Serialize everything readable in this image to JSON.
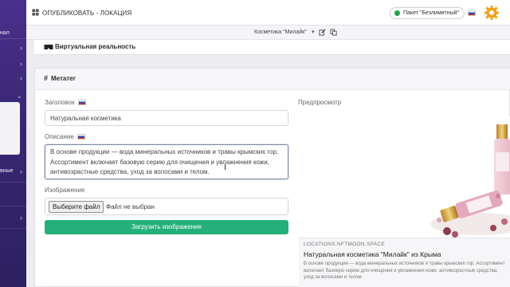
{
  "sidebar": {
    "items": [
      {
        "label": "нал"
      },
      {
        "label": ""
      },
      {
        "label": ""
      },
      {
        "label": ""
      },
      {
        "label": ""
      },
      {
        "label": "вные"
      },
      {
        "label": ""
      },
      {
        "label": ""
      },
      {
        "label": ""
      }
    ]
  },
  "topbar": {
    "title": "ОПУБЛИКОВАТЬ - ЛОКАЦИЯ",
    "plan_label": "Пакет \"Безлимитный\"",
    "accent_color": "#1fa34a"
  },
  "subheader": {
    "brand_select": "Косметика \"Милайк\"",
    "caret": "▾"
  },
  "vr_section": {
    "title": "Виртуальная реальность"
  },
  "meta_section": {
    "title": "Метатег",
    "title_label": "Заголовок",
    "title_value": "Натуральная косметика",
    "description_label": "Описание",
    "description_value": "В основе продукции — вода минеральных источников и травы крымских гор. Ассортимент включает базовую серию для очищения и увлажнения кожи, антивозрастные средства, уход за волосами и телом.",
    "image_label": "Изображение",
    "file_button": "Выберите файл",
    "file_status": "Файл не выбран",
    "upload_button": "Загрузить изображение",
    "upload_color": "#25b07a"
  },
  "preview": {
    "label": "Предпросмотр",
    "domain": "LOCATIONS.NFTMOON.SPACE",
    "title": "Натуральная косметика \"Милайк\" из Крыма",
    "description": "В основе продукции — вода минеральных источников и травы крымских гор. Ассортимент включает базовую серию для очищения и увлажнения кожи, антивозрастные средства, уход за волосами и телом."
  }
}
